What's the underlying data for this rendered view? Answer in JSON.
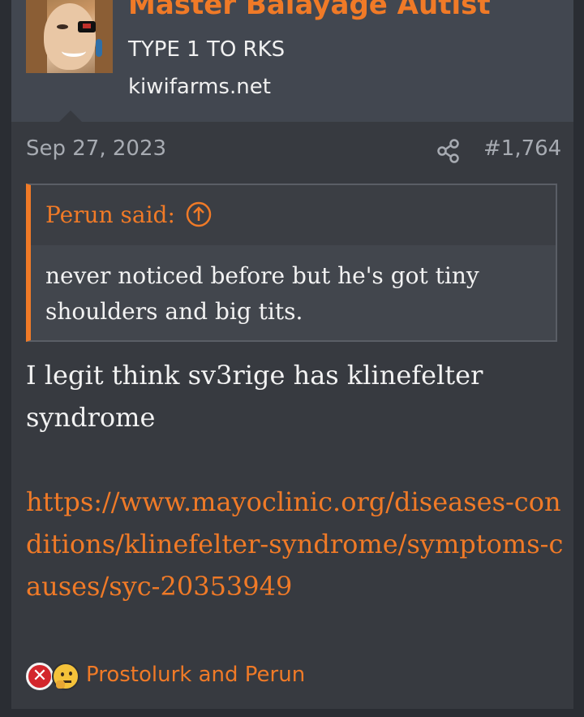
{
  "user": {
    "name": "Master Balayage Autist",
    "title": "TYPE 1 TO RKS",
    "site": "kiwifarms.net"
  },
  "post": {
    "date": "Sep 27, 2023",
    "number": "#1,764",
    "quote": {
      "author": "Perun said:",
      "text": "never noticed before but he's got tiny shoulders and big tits."
    },
    "body": "I legit think sv3rige has klinefelter syndrome",
    "link": "https://www.mayoclinic.org/diseases-conditions/klinefelter-syndrome/symptoms-causes/syc-20353949"
  },
  "reactions": {
    "icons": [
      "x-reaction-icon",
      "thinking-face-icon"
    ],
    "names": "Prostolurk and Perun"
  },
  "colors": {
    "accent": "#f07a27",
    "background": "#2a2d33",
    "post_bg": "#373a40",
    "header_bg": "#424750"
  }
}
